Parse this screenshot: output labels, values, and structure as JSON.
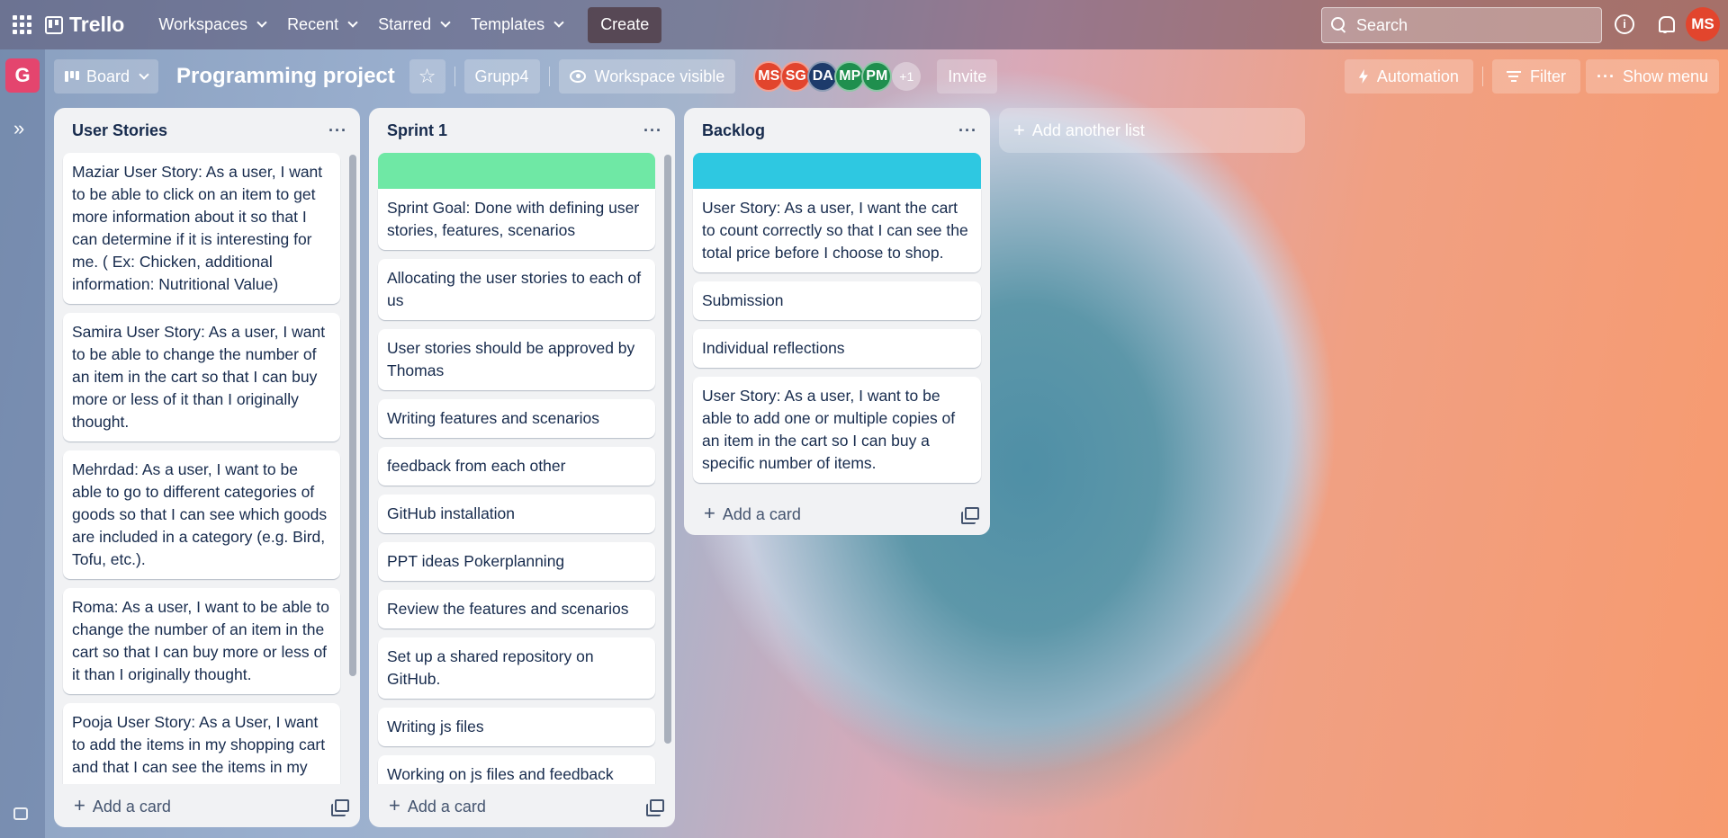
{
  "topbar": {
    "brand": "Trello",
    "nav": [
      "Workspaces",
      "Recent",
      "Starred",
      "Templates"
    ],
    "create_label": "Create",
    "search_placeholder": "Search",
    "user_initials": "MS"
  },
  "rail": {
    "workspace_initial": "G"
  },
  "board_header": {
    "view_label": "Board",
    "title": "Programming project",
    "workspace_label": "Grupp4",
    "visibility_label": "Workspace visible",
    "members": [
      {
        "initials": "MS",
        "color": "#e2452d"
      },
      {
        "initials": "SG",
        "color": "#e2452d"
      },
      {
        "initials": "DA",
        "color": "#1d3b6b"
      },
      {
        "initials": "MP",
        "color": "#1f8f4e"
      },
      {
        "initials": "PM",
        "color": "#1f8f4e"
      }
    ],
    "more_members": "+1",
    "invite_label": "Invite",
    "automation_label": "Automation",
    "filter_label": "Filter",
    "show_menu_label": "Show menu"
  },
  "lists": [
    {
      "title": "User Stories",
      "cover": null,
      "cards": [
        "Maziar User Story: As a user, I want to be able to click on an item to get more information about it so that I can determine if it is interesting for me. ( Ex: Chicken, additional information: Nutritional Value)",
        "Samira User Story: As a user, I want to be able to change the number of an item in the cart so that I can buy more or less of it than I originally thought.",
        "Mehrdad: As a user, I want to be able to go to different categories of goods so that I can see which goods are included in a category (e.g. Bird, Tofu, etc.).",
        "Roma: As a user, I want to be able to change the number of an item in the cart so that I can buy more or less of it than I originally thought.",
        "Pooja User Story: As a User, I want to add the items in my shopping cart and that I can see the items in my cart ."
      ],
      "add_card_label": "Add a card"
    },
    {
      "title": "Sprint 1",
      "cover": "#6fe8a5",
      "cards": [
        "Sprint Goal: Done with defining user stories, features, scenarios",
        "Allocating the user stories to each of us",
        "User stories should be approved by Thomas",
        "Writing features and scenarios",
        "feedback from each other",
        "GitHub installation",
        "PPT ideas Pokerplanning",
        "Review the features and scenarios",
        "Set up a shared repository on GitHub.",
        "Writing js files",
        "Working on js files and feedback from each other"
      ],
      "add_card_label": "Add a card"
    },
    {
      "title": "Backlog",
      "cover": "#2ec8e1",
      "cards": [
        "User Story: As a user, I want the cart to count correctly so that I can see the total price before I choose to shop.",
        "Submission",
        "Individual reflections",
        "User Story: As a user, I want to be able to add one or multiple copies of an item in the cart so I can buy a specific number of items."
      ],
      "add_card_label": "Add a card"
    }
  ],
  "add_list_label": "Add another list"
}
